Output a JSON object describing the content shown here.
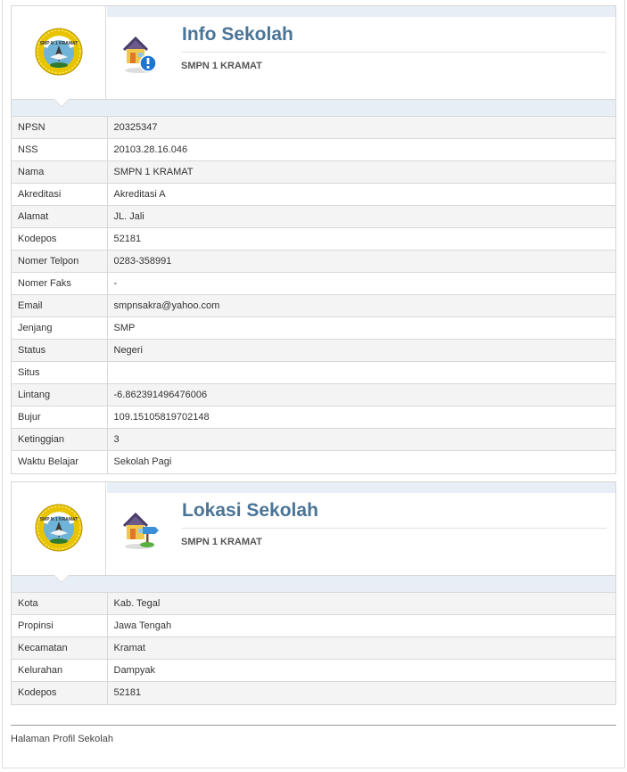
{
  "info": {
    "title": "Info Sekolah",
    "subtitle": "SMPN 1 KRAMAT",
    "icon": "house-info-icon",
    "rows": [
      {
        "label": "NPSN",
        "value": "20325347"
      },
      {
        "label": "NSS",
        "value": "20103.28.16.046"
      },
      {
        "label": "Nama",
        "value": "SMPN 1 KRAMAT"
      },
      {
        "label": "Akreditasi",
        "value": "Akreditasi A"
      },
      {
        "label": "Alamat",
        "value": "JL. Jali"
      },
      {
        "label": "Kodepos",
        "value": "52181"
      },
      {
        "label": "Nomer Telpon",
        "value": "0283-358991"
      },
      {
        "label": "Nomer Faks",
        "value": "-"
      },
      {
        "label": "Email",
        "value": "smpnsakra@yahoo.com"
      },
      {
        "label": "Jenjang",
        "value": "SMP"
      },
      {
        "label": "Status",
        "value": "Negeri"
      },
      {
        "label": "Situs",
        "value": ""
      },
      {
        "label": "Lintang",
        "value": "-6.862391496476006"
      },
      {
        "label": "Bujur",
        "value": "109.15105819702148"
      },
      {
        "label": "Ketinggian",
        "value": "3"
      },
      {
        "label": "Waktu Belajar",
        "value": "Sekolah Pagi"
      }
    ]
  },
  "lokasi": {
    "title": "Lokasi Sekolah",
    "subtitle": "SMPN 1 KRAMAT",
    "icon": "house-location-icon",
    "rows": [
      {
        "label": "Kota",
        "value": "Kab. Tegal"
      },
      {
        "label": "Propinsi",
        "value": "Jawa Tengah"
      },
      {
        "label": "Kecamatan",
        "value": "Kramat"
      },
      {
        "label": "Kelurahan",
        "value": "Dampyak"
      },
      {
        "label": "Kodepos",
        "value": "52181"
      }
    ]
  },
  "logo": {
    "text": "SMP N 1 KRAMAT",
    "icon": "school-emblem-icon"
  },
  "footer": {
    "text": "Halaman Profil Sekolah"
  },
  "colors": {
    "title": "#4a7496",
    "band": "#e8eef5",
    "row_alt": "#f4f4f4"
  }
}
